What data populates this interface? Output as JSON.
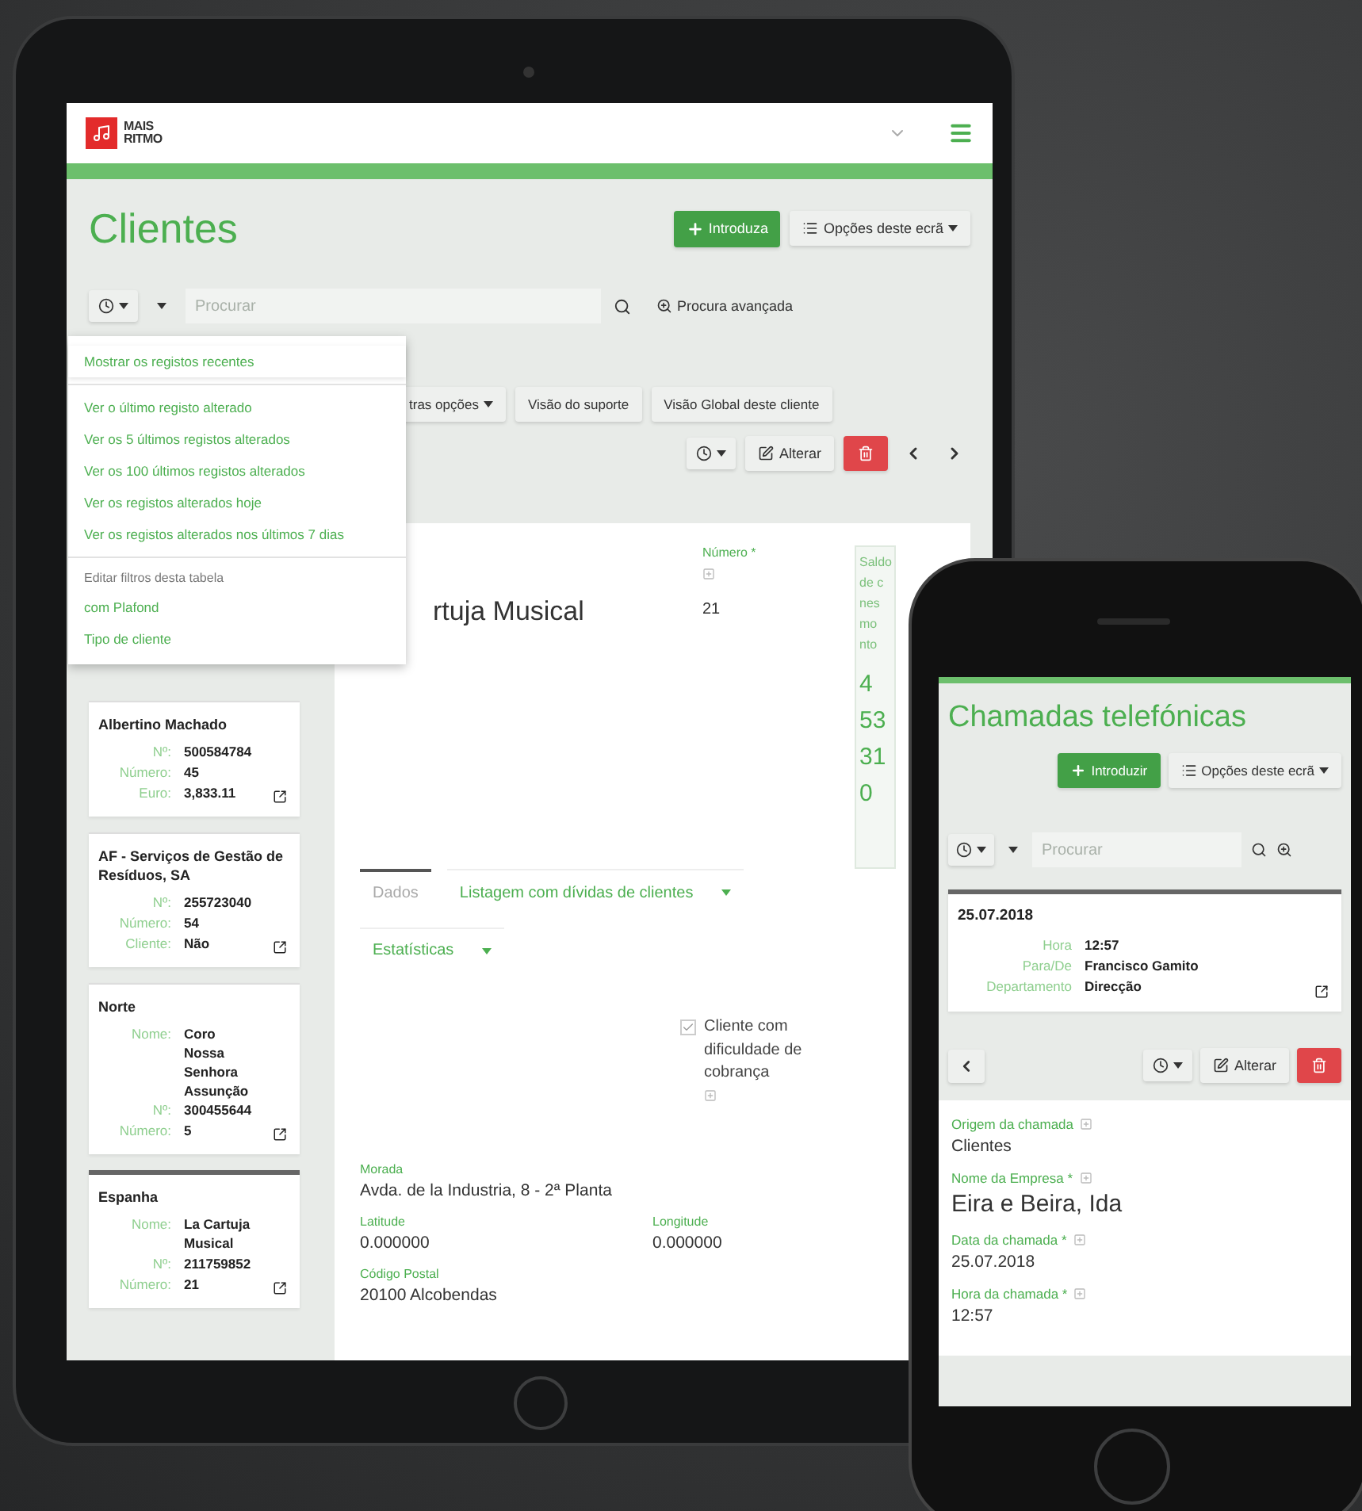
{
  "tablet": {
    "logo": {
      "line1": "MAIS",
      "line2": "RITMO"
    },
    "title": "Clientes",
    "add_button": "Introduza",
    "options_button": "Opções deste ecrã",
    "search": {
      "placeholder": "Procurar",
      "advanced": "Procura avançada"
    },
    "menu": {
      "sections": [
        {
          "items": [
            {
              "label": "Mostrar os registos recentes",
              "selected": true
            }
          ]
        },
        {
          "items": [
            {
              "label": "Ver o último registo alterado",
              "selected": false
            },
            {
              "label": "Ver os 5 últimos registos alterados",
              "selected": false
            },
            {
              "label": "Ver os 100 últimos registos alterados",
              "selected": false
            },
            {
              "label": "Ver os registos alterados hoje",
              "selected": false
            },
            {
              "label": "Ver os registos alterados nos últimos 7 dias",
              "selected": false
            }
          ]
        },
        {
          "heading": "Editar filtros desta tabela",
          "items": [
            {
              "label": "com Plafond",
              "selected": false
            },
            {
              "label": "Tipo de cliente",
              "selected": false
            }
          ]
        }
      ]
    },
    "nav_tabs": [
      {
        "label": "tras opções",
        "dropdown": true
      },
      {
        "label": "Visão do suporte",
        "dropdown": false
      },
      {
        "label": "Visão Global deste cliente",
        "dropdown": false
      }
    ],
    "edit_button": "Alterar",
    "records": [
      {
        "title": "Albertino Machado",
        "selected": false,
        "fields": [
          {
            "label": "Nº:",
            "value": "500584784"
          },
          {
            "label": "Número:",
            "value": "45"
          },
          {
            "label": "Euro:",
            "value": "3,833.11"
          }
        ]
      },
      {
        "title": "AF - Serviços de Gestão de Resíduos, SA",
        "selected": false,
        "fields": [
          {
            "label": "Nº:",
            "value": "255723040"
          },
          {
            "label": "Número:",
            "value": "54"
          },
          {
            "label": "Cliente:",
            "value": "Não"
          }
        ]
      },
      {
        "title": "Norte",
        "selected": false,
        "fields": [
          {
            "label": "Nome:",
            "value": "Coro Nossa Senhora Assunção"
          },
          {
            "label": "Nº:",
            "value": "300455644"
          },
          {
            "label": "Número:",
            "value": "5"
          }
        ]
      },
      {
        "title": "Espanha",
        "selected": true,
        "fields": [
          {
            "label": "Nome:",
            "value": "La Cartuja Musical"
          },
          {
            "label": "Nº:",
            "value": "211759852"
          },
          {
            "label": "Número:",
            "value": "21"
          }
        ]
      }
    ],
    "detail": {
      "name": "rtuja Musical",
      "number_label": "Número *",
      "number": "21",
      "balance": {
        "label_lines": [
          "Saldo",
          "de c",
          "nes",
          "mo",
          "nto"
        ],
        "values": [
          "4",
          "53",
          "31",
          "0"
        ]
      },
      "tabs": [
        {
          "label": "Dados",
          "selected": true,
          "dropdown": false
        },
        {
          "label": "Listagem com dívidas de clientes",
          "selected": false,
          "dropdown": true
        },
        {
          "label": "Estatísticas",
          "selected": false,
          "dropdown": true
        }
      ],
      "checkbox": {
        "label": "Cliente com dificuldade de cobrança",
        "checked": true
      },
      "address": {
        "label": "Morada",
        "value": "Avda. de la Industria, 8 - 2ª Planta"
      },
      "coords": [
        {
          "label": "Latitude",
          "value": "0.000000"
        },
        {
          "label": "Longitude",
          "value": "0.000000"
        }
      ],
      "postal": {
        "label": "Código Postal",
        "value": "20100 Alcobendas"
      }
    }
  },
  "phone": {
    "title": "Chamadas telefónicas",
    "add_button": "Introduzir",
    "options_button": "Opções deste ecrã",
    "search": {
      "placeholder": "Procurar"
    },
    "record": {
      "title": "25.07.2018",
      "selected": true,
      "fields": [
        {
          "label": "Hora",
          "value": "12:57"
        },
        {
          "label": "Para/De",
          "value": "Francisco Gamito"
        },
        {
          "label": "Departamento",
          "value": "Direcção"
        }
      ]
    },
    "edit_button": "Alterar",
    "fields": [
      {
        "label": "Origem da chamada",
        "value": "Clientes",
        "large": false
      },
      {
        "label": "Nome da Empresa *",
        "value": "Eira e Beira, Ida",
        "large": true
      },
      {
        "label": "Data da chamada *",
        "value": "25.07.2018",
        "large": false
      },
      {
        "label": "Hora da chamada *",
        "value": "12:57",
        "large": false
      }
    ]
  }
}
